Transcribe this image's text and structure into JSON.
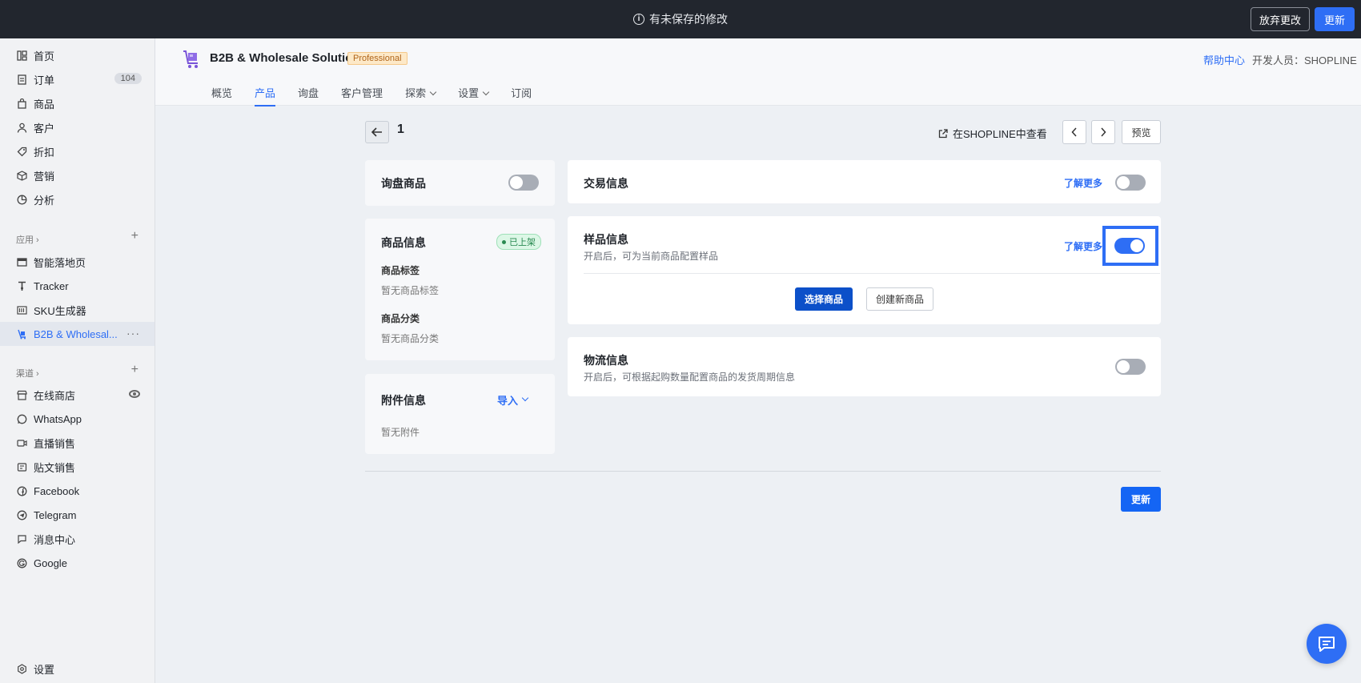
{
  "topbar": {
    "message": "有未保存的修改",
    "discard_label": "放弃更改",
    "update_label": "更新"
  },
  "sidebar": {
    "main_items": [
      {
        "label": "首页",
        "icon": "dashboard-icon"
      },
      {
        "label": "订单",
        "icon": "order-icon",
        "count": "104"
      },
      {
        "label": "商品",
        "icon": "bag-icon"
      },
      {
        "label": "客户",
        "icon": "person-icon"
      },
      {
        "label": "折扣",
        "icon": "tag-icon"
      },
      {
        "label": "营销",
        "icon": "cube-icon"
      },
      {
        "label": "分析",
        "icon": "pie-icon"
      }
    ],
    "apps_label": "应用",
    "app_items": [
      {
        "label": "智能落地页",
        "icon": "layout-icon"
      },
      {
        "label": "Tracker",
        "icon": "tracker-icon"
      },
      {
        "label": "SKU生成器",
        "icon": "barcode-icon"
      },
      {
        "label": "B2B & Wholesal...",
        "icon": "b2b-icon"
      }
    ],
    "channels_label": "渠道",
    "channel_items": [
      {
        "label": "在线商店",
        "icon": "store-icon"
      },
      {
        "label": "WhatsApp",
        "icon": "whatsapp-icon"
      },
      {
        "label": "直播销售",
        "icon": "live-icon"
      },
      {
        "label": "贴文销售",
        "icon": "post-icon"
      },
      {
        "label": "Facebook",
        "icon": "facebook-icon"
      },
      {
        "label": "Telegram",
        "icon": "telegram-icon"
      },
      {
        "label": "消息中心",
        "icon": "message-icon"
      },
      {
        "label": "Google",
        "icon": "google-icon"
      }
    ],
    "settings_label": "设置"
  },
  "header": {
    "app_name": "B2B & Wholesale Solution",
    "plan": "Professional",
    "help": "帮助中心",
    "developer": "开发人员：SHOPLINE",
    "tabs": [
      {
        "label": "概览"
      },
      {
        "label": "产品"
      },
      {
        "label": "询盘"
      },
      {
        "label": "客户管理"
      },
      {
        "label": "探索"
      },
      {
        "label": "设置"
      },
      {
        "label": "订阅"
      }
    ]
  },
  "page": {
    "title": "1",
    "view_in_shopline": "在SHOPLINE中查看",
    "preview": "预览",
    "update": "更新"
  },
  "inquiry_card": {
    "title": "询盘商品",
    "enabled": false
  },
  "product_info": {
    "title": "商品信息",
    "status": "已上架",
    "tags_label": "商品标签",
    "tags_value": "暂无商品标签",
    "category_label": "商品分类",
    "category_value": "暂无商品分类"
  },
  "attachment": {
    "title": "附件信息",
    "import_label": "导入",
    "empty": "暂无附件"
  },
  "trade_info": {
    "title": "交易信息",
    "learn_more": "了解更多",
    "enabled": false
  },
  "sample_info": {
    "title": "样品信息",
    "subtitle": "开启后，可为当前商品配置样品",
    "learn_more": "了解更多",
    "enabled": true,
    "select_label": "选择商品",
    "create_label": "创建新商品"
  },
  "logistics_info": {
    "title": "物流信息",
    "subtitle": "开启后，可根据起购数量配置商品的发货周期信息",
    "enabled": false
  },
  "colors": {
    "accent": "#2e6ef5",
    "topbar": "#22262e",
    "primary_dark": "#0c50c9"
  }
}
